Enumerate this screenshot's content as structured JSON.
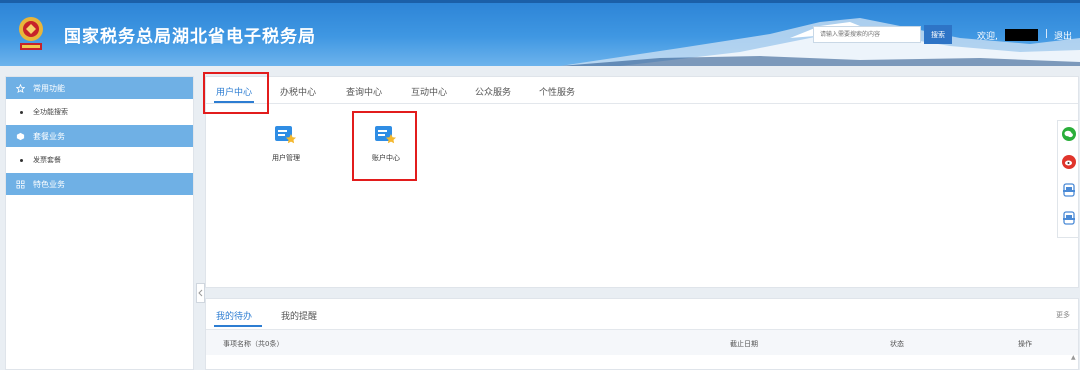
{
  "header": {
    "title": "国家税务总局湖北省电子税务局",
    "search_placeholder": "请输入需要搜索的内容",
    "search_button": "搜索",
    "welcome": "欢迎,",
    "separator": "|",
    "logout": "退出"
  },
  "sidebar": {
    "groups": [
      {
        "label": "常用功能",
        "icon": "star-icon",
        "items": [
          "全功能搜索"
        ]
      },
      {
        "label": "套餐业务",
        "icon": "cube-icon",
        "items": [
          "发票套餐"
        ]
      },
      {
        "label": "特色业务",
        "icon": "grid-icon",
        "items": []
      }
    ]
  },
  "main": {
    "tabs": [
      "用户中心",
      "办税中心",
      "查询中心",
      "互动中心",
      "公众服务",
      "个性服务"
    ],
    "active_tab": "用户中心",
    "apps": [
      {
        "label": "用户管理",
        "icon": "user-card-icon"
      },
      {
        "label": "账户中心",
        "icon": "account-card-icon"
      }
    ]
  },
  "bottom": {
    "tabs": [
      "我的待办",
      "我的提醒"
    ],
    "more": "更多",
    "columns": [
      "事项名称（共0条）",
      "截止日期",
      "状态",
      "操作"
    ]
  },
  "floating": [
    "wechat-icon",
    "weibo-icon",
    "app-icon",
    "app-icon"
  ],
  "colors": {
    "brand": "#2c83d6",
    "accent": "#2d7dd2",
    "highlight": "#e21c1c",
    "sidebar_group": "#6fb0e5"
  }
}
